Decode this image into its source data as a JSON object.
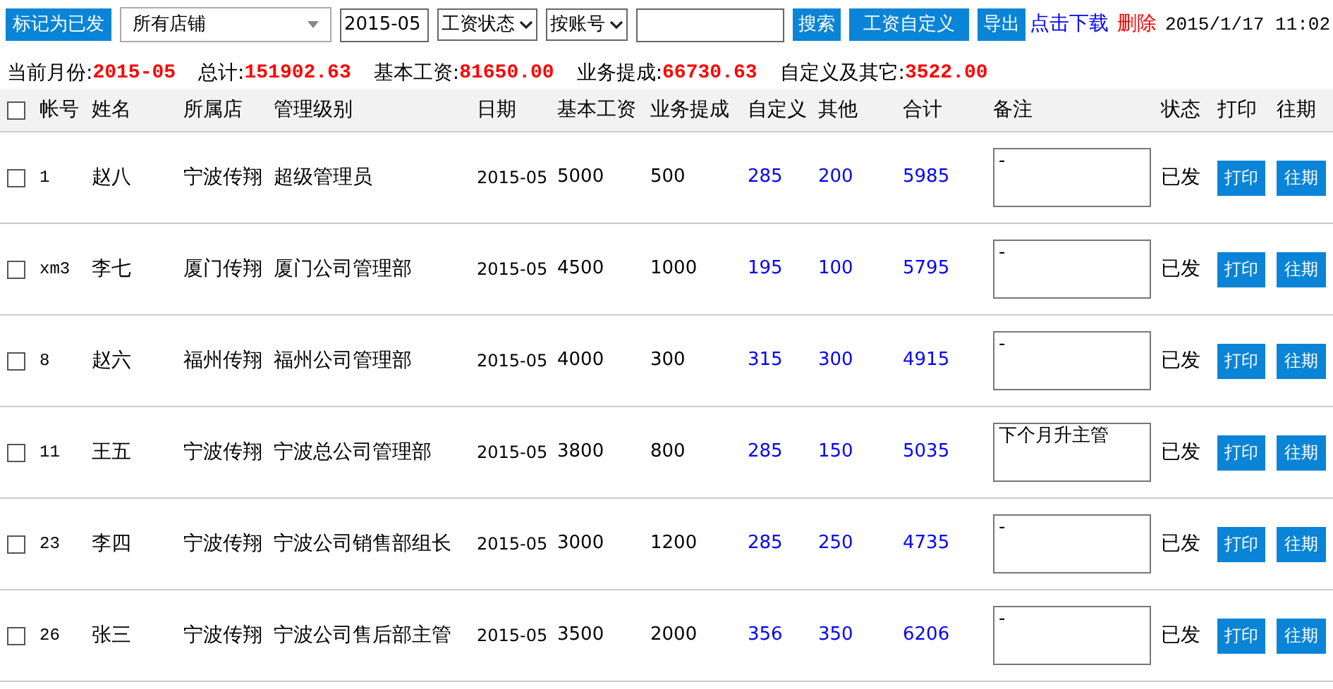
{
  "toolbar": {
    "mark_button": "标记为已发",
    "store_select": {
      "value": "所有店铺"
    },
    "month_field": {
      "value": "2015-05"
    },
    "status_select": {
      "value": "工资状态"
    },
    "sort_select": {
      "value": "按账号"
    },
    "buttons": [
      "搜索",
      "工资自定义",
      "导出"
    ],
    "download_link": "点击下载",
    "delete_link": "删除",
    "datetime": "2015/1/17 11:02"
  },
  "summary": [
    {
      "label": "当前月份:",
      "value": "2015-05"
    },
    {
      "label": "总计:",
      "value": "151902.63"
    },
    {
      "label": "基本工资:",
      "value": "81650.00"
    },
    {
      "label": "业务提成:",
      "value": "66730.63"
    },
    {
      "label": "自定义及其它:",
      "value": "3522.00"
    }
  ],
  "table": {
    "select_all": {
      "checked": false
    },
    "columns": [
      "帐号",
      "姓名",
      "所属店",
      "管理级别",
      "日期",
      "基本工资",
      "业务提成",
      "自定义",
      "其他",
      "合计",
      "备注",
      "状态",
      "打印",
      "往期"
    ],
    "rows": [
      {
        "checked": false,
        "account": "1",
        "name": "赵八",
        "store": "宁波传翔",
        "level": "超级管理员",
        "date": "2015-05",
        "base": "5000",
        "commission": "500",
        "custom": "285",
        "other": "200",
        "total": "5985",
        "note": "-",
        "status": "已发",
        "print": "打印",
        "history": "往期"
      },
      {
        "checked": false,
        "account": "xm3",
        "name": "李七",
        "store": "厦门传翔",
        "level": "厦门公司管理部",
        "date": "2015-05",
        "base": "4500",
        "commission": "1000",
        "custom": "195",
        "other": "100",
        "total": "5795",
        "note": "-",
        "status": "已发",
        "print": "打印",
        "history": "往期"
      },
      {
        "checked": false,
        "account": "8",
        "name": "赵六",
        "store": "福州传翔",
        "level": "福州公司管理部",
        "date": "2015-05",
        "base": "4000",
        "commission": "300",
        "custom": "315",
        "other": "300",
        "total": "4915",
        "note": "-",
        "status": "已发",
        "print": "打印",
        "history": "往期"
      },
      {
        "checked": false,
        "account": "11",
        "name": "王五",
        "store": "宁波传翔",
        "level": "宁波总公司管理部",
        "date": "2015-05",
        "base": "3800",
        "commission": "800",
        "custom": "285",
        "other": "150",
        "total": "5035",
        "note": "下个月升主管",
        "status": "已发",
        "print": "打印",
        "history": "往期"
      },
      {
        "checked": false,
        "account": "23",
        "name": "李四",
        "store": "宁波传翔",
        "level": "宁波公司销售部组长",
        "date": "2015-05",
        "base": "3000",
        "commission": "1200",
        "custom": "285",
        "other": "250",
        "total": "4735",
        "note": "-",
        "status": "已发",
        "print": "打印",
        "history": "往期"
      },
      {
        "checked": false,
        "account": "26",
        "name": "张三",
        "store": "宁波传翔",
        "level": "宁波公司售后部主管",
        "date": "2015-05",
        "base": "3500",
        "commission": "2000",
        "custom": "356",
        "other": "350",
        "total": "6206",
        "note": "-",
        "status": "已发",
        "print": "打印",
        "history": "往期"
      }
    ]
  }
}
